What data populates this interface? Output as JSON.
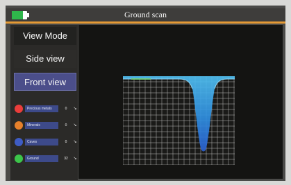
{
  "window": {
    "title": "Ground scan"
  },
  "sidebar": {
    "view_mode_label": "View Mode",
    "side_view_label": "Side view",
    "front_view_label": "Front view"
  },
  "legend": [
    {
      "label": "Precious metals",
      "value": "0",
      "color": "#ea3d3b"
    },
    {
      "label": "Minerals",
      "value": "0",
      "color": "#e6802b"
    },
    {
      "label": "Caves",
      "value": "0",
      "color": "#3e5cc4"
    },
    {
      "label": "Ground",
      "value": "32",
      "color": "#3cc54a"
    }
  ],
  "colors": {
    "accent": "#e59a35",
    "battery": "#2fb64b",
    "selected_button": "#4b4e8a",
    "scan_surface": "#36a4e8"
  }
}
